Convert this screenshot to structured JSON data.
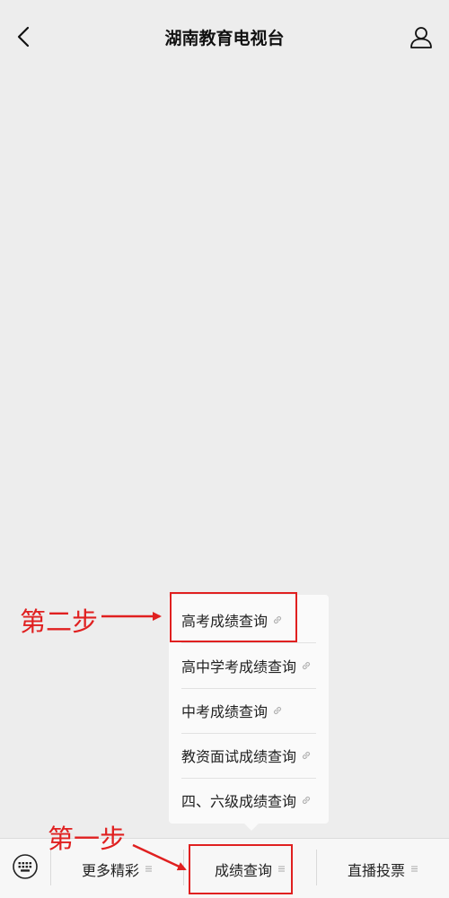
{
  "header": {
    "title": "湖南教育电视台",
    "back_icon": "chevron-left-icon",
    "profile_icon": "user-icon"
  },
  "popup": {
    "items": [
      {
        "label": "高考成绩查询",
        "icon": "link-icon"
      },
      {
        "label": "高中学考成绩查询",
        "icon": "link-icon"
      },
      {
        "label": "中考成绩查询",
        "icon": "link-icon"
      },
      {
        "label": "教资面试成绩查询",
        "icon": "link-icon"
      },
      {
        "label": "四、六级成绩查询",
        "icon": "link-icon"
      }
    ]
  },
  "menubar": {
    "keyboard_icon": "keyboard-icon",
    "items": [
      {
        "label": "更多精彩",
        "icon": "menu-icon"
      },
      {
        "label": "成绩查询",
        "icon": "menu-icon"
      },
      {
        "label": "直播投票",
        "icon": "menu-icon"
      }
    ]
  },
  "annotations": {
    "step1": "第一步",
    "step2": "第二步",
    "color": "#e02020"
  }
}
